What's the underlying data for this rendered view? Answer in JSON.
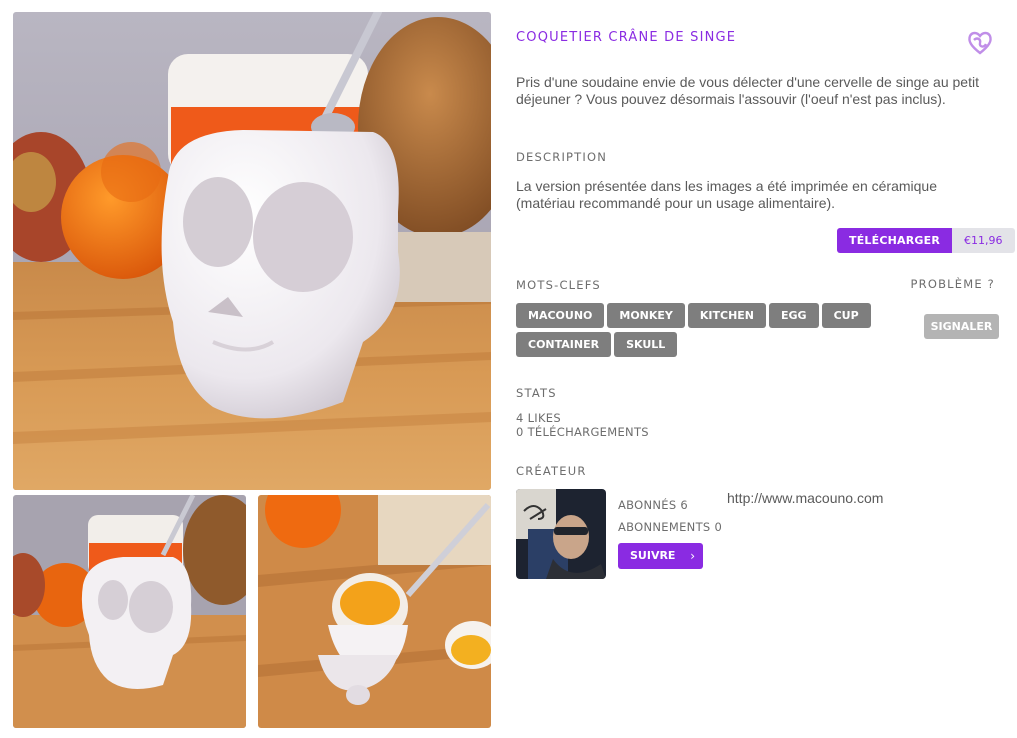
{
  "product": {
    "title": "COQUETIER CRÂNE DE SINGE",
    "intro": "Pris d'une soudaine envie de vous délecter d'une cervelle de singe au petit déjeuner ? Vous pouvez désormais l'assouvir (l'oeuf n'est pas inclus).",
    "favorite_icon": "heart-icon"
  },
  "description": {
    "label": "DESCRIPTION",
    "text": "La version présentée dans les images a été imprimée en céramique (matériau recommandé pour un usage alimentaire)."
  },
  "download": {
    "label": "TÉLÉCHARGER",
    "price": "€11,96"
  },
  "keywords": {
    "label": "MOTS-CLEFS",
    "tags": [
      "MACOUNO",
      "MONKEY",
      "KITCHEN",
      "EGG",
      "CUP",
      "CONTAINER",
      "SKULL"
    ]
  },
  "problem": {
    "label": "PROBLÈME ?",
    "report_label": "SIGNALER"
  },
  "stats": {
    "label": "STATS",
    "likes": "4 LIKES",
    "downloads": "0 TÉLÉCHARGEMENTS"
  },
  "creator": {
    "label": "CRÉATEUR",
    "followers": "ABONNÉS 6",
    "following": "ABONNEMENTS 0",
    "follow_label": "SUIVRE",
    "follow_icon": "chevron-right-icon",
    "url": "http://www.macouno.com"
  },
  "colors": {
    "accent": "#8a2be2",
    "tag_bg": "#7e7e7e",
    "report_bg": "#b4b4b4"
  }
}
